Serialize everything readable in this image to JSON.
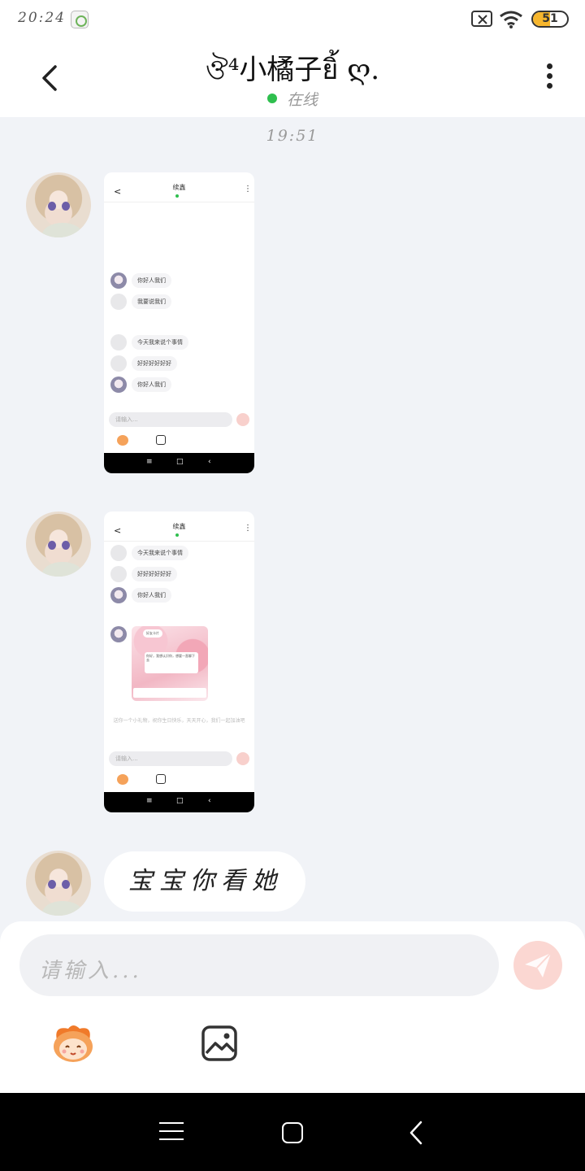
{
  "status_bar": {
    "time": "20:24",
    "battery_level": "51",
    "battery_fraction": 0.51,
    "icons": [
      "app-icon",
      "close-box-icon",
      "wifi-icon",
      "battery-icon"
    ]
  },
  "header": {
    "title": "ঔ⁴小橘子ยิ้ ღ.",
    "status": "在线",
    "back_icon": "chevron-left-icon",
    "more_icon": "more-vertical-icon"
  },
  "chat": {
    "timestamp": "19:51",
    "messages": [
      {
        "type": "image",
        "content": "screenshot",
        "screenshot": {
          "title": "续鑫",
          "rows": [
            {
              "avatar": "pic",
              "text": "你好人我们"
            },
            {
              "avatar": "blank",
              "text": "我要说我们"
            },
            {
              "avatar": "blank",
              "text": "今天我来说个事情"
            },
            {
              "avatar": "blank",
              "text": "好好好好好好"
            },
            {
              "avatar": "pic",
              "text": "你好人我们"
            }
          ],
          "input_placeholder": "请输入..."
        }
      },
      {
        "type": "image",
        "content": "screenshot",
        "screenshot": {
          "title": "续鑫",
          "rows": [
            {
              "avatar": "blank",
              "text": "今天我来说个事情"
            },
            {
              "avatar": "blank",
              "text": "好好好好好好"
            },
            {
              "avatar": "pic",
              "text": "你好人我们"
            }
          ],
          "card_top": "好友卡片",
          "card_text": "你好，我想认识你，想要一直聊下去",
          "note": "送你一个小礼物，祝你生日快乐，天天开心，我们一起加油吧",
          "input_placeholder": "请输入..."
        }
      },
      {
        "type": "text",
        "text": "宝宝你看她"
      }
    ]
  },
  "input": {
    "placeholder": "请输入...",
    "send_icon": "send-icon",
    "emoji_icon": "emoji-face-icon",
    "image_icon": "image-icon"
  },
  "nav": {
    "icons": [
      "menu-icon",
      "home-icon",
      "back-icon"
    ]
  },
  "colors": {
    "online": "#2fbf4e",
    "background": "#f1f3f7",
    "send_button": "#fbd7d2",
    "battery": "#f6b62d"
  }
}
